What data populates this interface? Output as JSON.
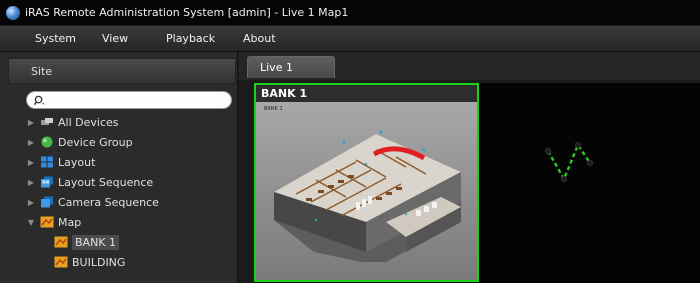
{
  "window": {
    "title": "iRAS Remote Administration System [admin] - Live 1  Map1"
  },
  "menu": {
    "items": [
      "System",
      "View",
      "Playback",
      "About"
    ]
  },
  "sidebar": {
    "header": "Site",
    "search": {
      "value": "",
      "placeholder": ""
    },
    "tree": [
      {
        "label": "All Devices",
        "icon": "devices-icon",
        "expanded": false
      },
      {
        "label": "Device Group",
        "icon": "device-group-icon",
        "expanded": false
      },
      {
        "label": "Layout",
        "icon": "layout-icon",
        "expanded": false
      },
      {
        "label": "Layout Sequence",
        "icon": "layout-sequence-icon",
        "expanded": false
      },
      {
        "label": "Camera Sequence",
        "icon": "camera-sequence-icon",
        "expanded": false
      },
      {
        "label": "Map",
        "icon": "map-icon",
        "expanded": true,
        "children": [
          {
            "label": "BANK 1",
            "icon": "map-icon",
            "selected": true
          },
          {
            "label": "BUILDING",
            "icon": "map-icon",
            "selected": false
          }
        ]
      }
    ]
  },
  "tabs": [
    {
      "label": "Live  1",
      "active": true
    }
  ],
  "viewport": {
    "map_panel": {
      "title": "BANK 1",
      "inner_label": "BANK 1"
    }
  },
  "colors": {
    "selection_border": "#19d219",
    "device_link": "#29c829"
  }
}
